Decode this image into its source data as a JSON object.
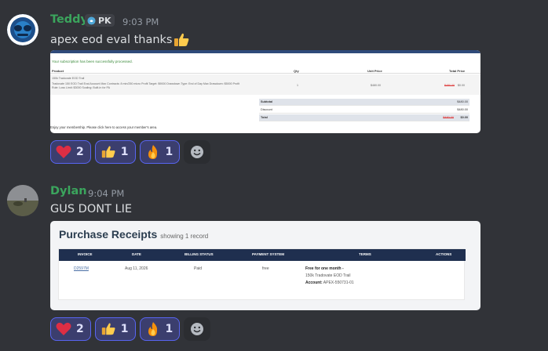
{
  "messages": [
    {
      "username": "Teddy",
      "tag": "PK",
      "timestamp": "9:03 PM",
      "text": "apex eod eval thanks",
      "reactions": [
        {
          "icon": "heart-icon",
          "count": "2"
        },
        {
          "icon": "thumbs-up-icon",
          "count": "1"
        },
        {
          "icon": "fire-icon",
          "count": "1"
        }
      ]
    },
    {
      "username": "Dylan",
      "timestamp": "9:04 PM",
      "text": "GUS DONT LIE",
      "reactions": [
        {
          "icon": "heart-icon",
          "count": "2"
        },
        {
          "icon": "thumbs-up-icon",
          "count": "1"
        },
        {
          "icon": "fire-icon",
          "count": "1"
        }
      ]
    }
  ],
  "receipt1": {
    "success": "Your subscription has been successfully processed.",
    "columns": [
      "Product",
      "Qty",
      "Unit Price",
      "Total Price"
    ],
    "product_name": "150k Tradovate EOD Trail",
    "product_desc": "Tradovate 150 EOD Trail Eval Account Max Contracts: 8 min/250 micro Profit Target: $9000 Drawdown Type: End of Day Max Drawdown: $5000 Profit Rule: Loss Limit: $3000 Scaling: Built-in for PA",
    "qty": "1",
    "unit_price": "$480.00",
    "old_price": "$480.00",
    "new_price": "$0.00",
    "totals": [
      {
        "label": "Subtotal",
        "value": "$480.00"
      },
      {
        "label": "Discount",
        "value": "$480.00"
      },
      {
        "label": "Total",
        "old": "$480.00",
        "value": "$0.00"
      }
    ],
    "footer": "Enjoy your membership. Please click here to access your member's area."
  },
  "receipt2": {
    "title": "Purchase Receipts",
    "subtitle": "showing 1 record",
    "columns": [
      "INVOICE",
      "DATE",
      "BILLING STATUS",
      "PAYMENT SYSTEM",
      "TERMS",
      "ACTIONS"
    ],
    "invoice": "D2597M",
    "date": "Aug 11, 2026",
    "status": "Paid",
    "payment": "free",
    "terms_title": "Free for one month -",
    "terms_product": "150k Tradovate EOD Trail",
    "terms_account_label": "Account:",
    "terms_account": "APEX-550731-01"
  },
  "colors": {
    "background": "#313338",
    "username": "#3ba55d",
    "reaction_bg": "#3b3e6e",
    "reaction_border": "#5865f2"
  }
}
